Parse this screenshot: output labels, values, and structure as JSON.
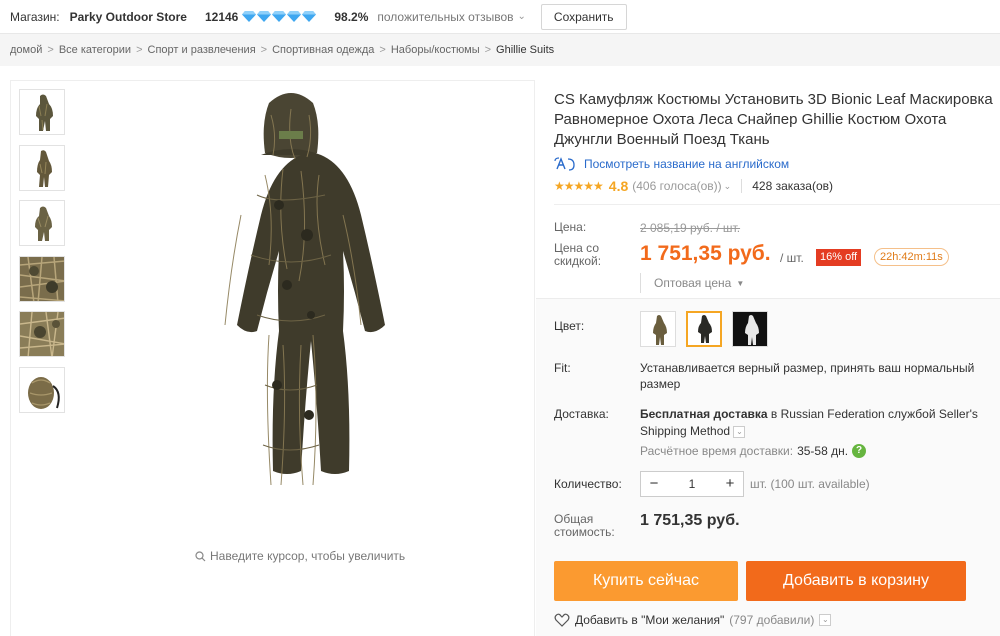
{
  "store": {
    "label": "Магазин:",
    "name": "Parky Outdoor Store",
    "feedback_count": "12146",
    "positive_pct": "98.2%",
    "positive_label": "положительных отзывов",
    "save_button": "Сохранить",
    "diamond_color": "#3fa7f0"
  },
  "breadcrumb": [
    "домой",
    "Все категории",
    "Спорт и развлечения",
    "Спортивная одежда",
    "Наборы/костюмы",
    "Ghillie Suits"
  ],
  "gallery": {
    "zoom_hint": "Наведите курсор, чтобы увеличить",
    "thumbnails": [
      "ghillie-front",
      "ghillie-side",
      "ghillie-back",
      "leaf-closeup",
      "leaf-detail",
      "carry-bag"
    ]
  },
  "product": {
    "title_lines": [
      "CS Камуфляж Костюмы Установить 3D Bionic Leaf Маскировка",
      "Равномерное Охота Леса Снайпер Ghillie Костюм Охота",
      "Джунгли Военный Поезд Ткань"
    ],
    "translate_link": "Посмотреть название на английском",
    "rating": "4.8",
    "votes": "(406 голоса(ов))",
    "orders": "428 заказа(ов)"
  },
  "price": {
    "label": "Цена:",
    "old": "2 085,19 руб. / шт.",
    "discount_label": "Цена со скидкой:",
    "new": "1 751,35 руб.",
    "unit": "/ шт.",
    "off_badge": "16% off",
    "timer": "22h:42m:11s",
    "wholesale": "Оптовая цена"
  },
  "options": {
    "color_label": "Цвет:",
    "color_swatches": [
      "woodland",
      "dark",
      "white"
    ],
    "selected_color": "dark",
    "fit_label": "Fit:",
    "fit_text": "Устанавливается верный размер, принять ваш нормальный размер",
    "shipping_label": "Доставка:",
    "shipping_bold": "Бесплатная доставка",
    "shipping_rest": " в Russian Federation службой Seller's Shipping Method",
    "delivery_time_label": "Расчётное время доставки:",
    "delivery_days": "35-58 дн.",
    "qty_label": "Количество:",
    "qty_value": "1",
    "qty_available": "шт. (100 шт. available)",
    "total_label": "Общая стоимость:",
    "total_value": "1 751,35 руб."
  },
  "actions": {
    "buy_now": "Купить сейчас",
    "add_to_cart": "Добавить в корзину",
    "wishlist": "Добавить в \"Мои желания\"",
    "wishlist_count": "(797 добавили)"
  },
  "colors": {
    "accent_orange": "#f26a1b",
    "buy_orange": "#fb9a30",
    "link_blue": "#2a6bcb",
    "star": "#f5a623",
    "sale_red": "#e43c22"
  }
}
